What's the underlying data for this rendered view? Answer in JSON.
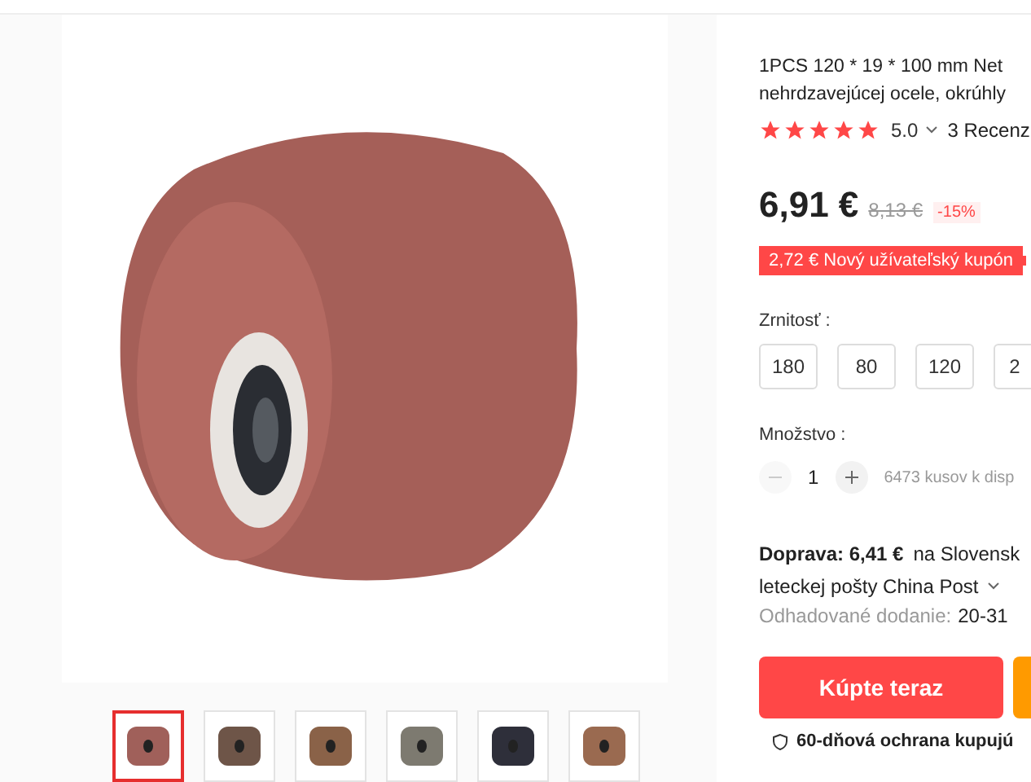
{
  "gallery": {
    "thumbnails": [
      {
        "color": "#a0605a",
        "selected": true
      },
      {
        "color": "#6e5548",
        "selected": false
      },
      {
        "color": "#8a6248",
        "selected": false
      },
      {
        "color": "#7d7a70",
        "selected": false
      },
      {
        "color": "#2e2f3a",
        "selected": false
      },
      {
        "color": "#9a6a50",
        "selected": false
      }
    ]
  },
  "product": {
    "title_lines": [
      "1PCS 120 * 19 * 100 mm Net",
      "nehrdzavejúcej ocele, okrúhly"
    ],
    "stars": 5,
    "rating": "5.0",
    "reviews": "3 Recenz",
    "price": "6,91 €",
    "old_price": "8,13 €",
    "discount": "-15%",
    "coupon": "2,72 € Nový užívateľský kupón",
    "grit": {
      "label": "Zrnitosť :",
      "options": [
        {
          "label": "180",
          "selected": false
        },
        {
          "label": "80",
          "selected": false
        },
        {
          "label": "120",
          "selected": false
        },
        {
          "label": "2",
          "selected": false
        }
      ]
    },
    "quantity": {
      "label": "Množstvo :",
      "value": "1",
      "minus_disabled": true,
      "stock": "6473 kusov k disp"
    },
    "shipping": {
      "label": "Doprava: 6,41 €",
      "destination": "na Slovensk",
      "method": "leteckej pošty China Post",
      "delivery_label": "Odhadované dodanie:",
      "delivery_value": "20-31"
    },
    "buy_button": "Kúpte teraz",
    "protection": "60-dňová ochrana kupujú"
  }
}
